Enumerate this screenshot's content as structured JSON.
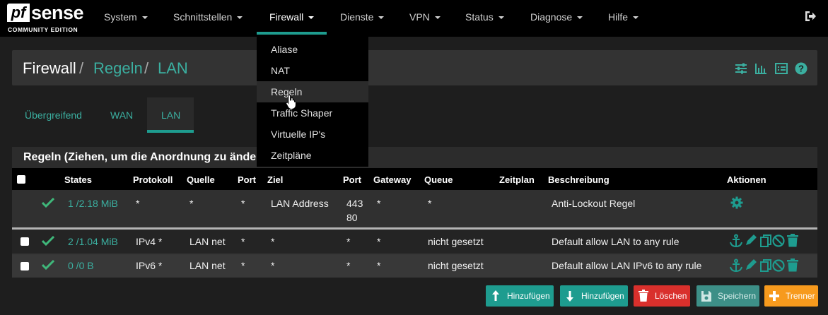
{
  "brand": {
    "logo_pf": "pf",
    "logo_sense": "sense",
    "edition": "COMMUNITY EDITION"
  },
  "nav": {
    "items": [
      "System",
      "Schnittstellen",
      "Firewall",
      "Dienste",
      "VPN",
      "Status",
      "Diagnose",
      "Hilfe"
    ],
    "active": "Firewall",
    "logout_icon": "sign-out-icon"
  },
  "dropdown": {
    "items": [
      "Aliase",
      "NAT",
      "Regeln",
      "Traffic Shaper",
      "Virtuelle IP's",
      "Zeitpläne"
    ],
    "hovered": "Regeln"
  },
  "breadcrumb": {
    "root": "Firewall",
    "sep": "/",
    "level2": "Regeln",
    "level3": "LAN"
  },
  "header_icons": [
    "sliders-icon",
    "bar-chart-icon",
    "list-icon",
    "help-icon"
  ],
  "tabs": {
    "items": [
      "Übergreifend",
      "WAN",
      "LAN"
    ],
    "active": "LAN"
  },
  "panel": {
    "title": "Regeln (Ziehen, um die Anordnung zu ände"
  },
  "table": {
    "headers": [
      "States",
      "Protokoll",
      "Quelle",
      "Port",
      "Ziel",
      "Port",
      "Gateway",
      "Queue",
      "Zeitplan",
      "Beschreibung",
      "Aktionen"
    ],
    "rows": [
      {
        "states": "1 /2.18 MiB",
        "protocol": "*",
        "source": "*",
        "port": "*",
        "dest": "LAN Address",
        "dport1": "443",
        "dport2": "80",
        "gateway": "*",
        "queue": "*",
        "schedule": "",
        "description": "Anti-Lockout Regel"
      },
      {
        "states": "2 /1.04 MiB",
        "protocol": "IPv4 *",
        "source": "LAN net",
        "port": "*",
        "dest": "*",
        "dport": "*",
        "gateway": "*",
        "queue": "nicht gesetzt",
        "schedule": "",
        "description": "Default allow LAN to any rule"
      },
      {
        "states": "0 /0 B",
        "protocol": "IPv6 *",
        "source": "LAN net",
        "port": "*",
        "dest": "*",
        "dport": "*",
        "gateway": "*",
        "queue": "nicht gesetzt",
        "schedule": "",
        "description": "Default allow LAN IPv6 to any rule"
      }
    ]
  },
  "buttons": {
    "add_top": "Hinzufügen",
    "add_bottom": "Hinzufügen",
    "delete": "Löschen",
    "save": "Speichern",
    "separator": "Trenner"
  },
  "colors": {
    "accent": "#1e9c8f",
    "link": "#3bafa0",
    "delete": "#d9302c",
    "save": "#3d8f87",
    "separator": "#f79a1d",
    "check": "#3fb77a"
  }
}
